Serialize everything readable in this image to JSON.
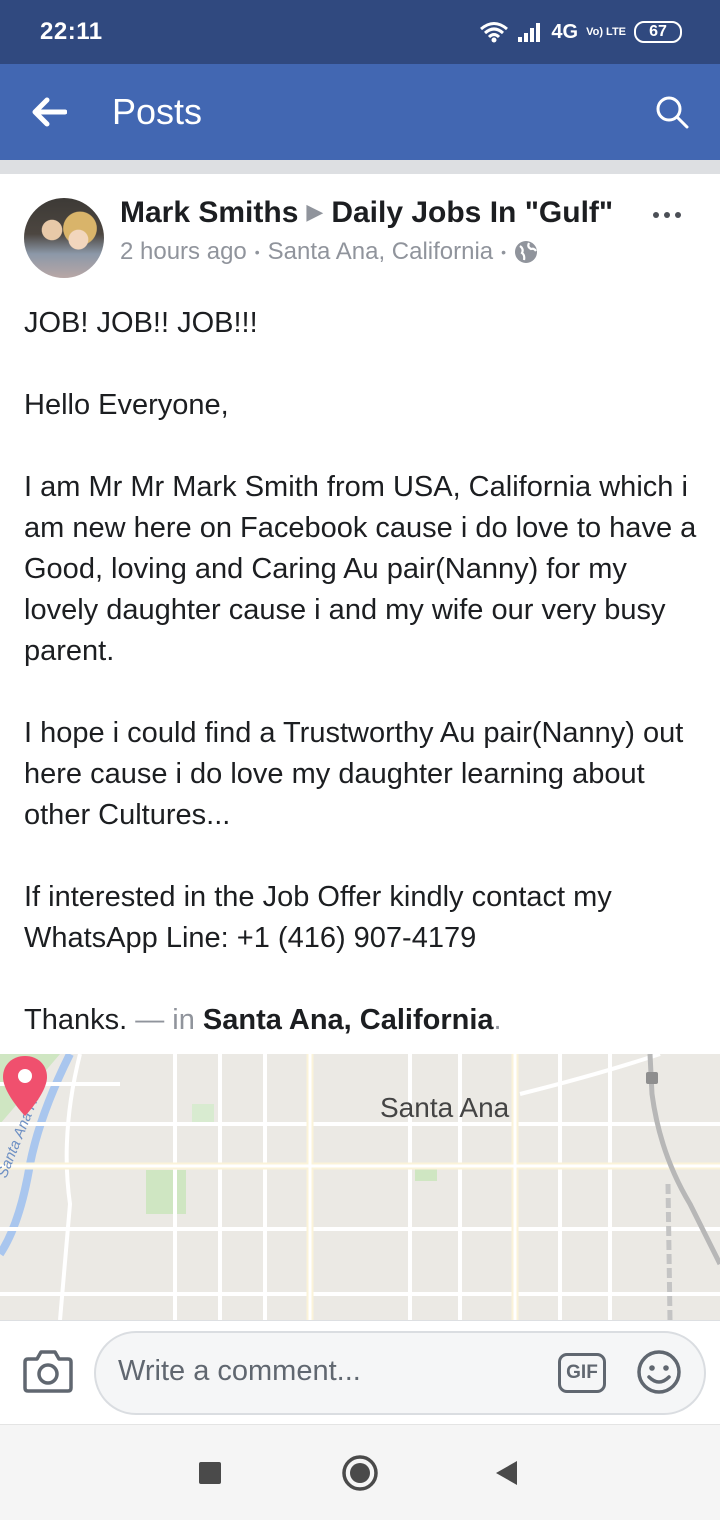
{
  "status_bar": {
    "time": "22:11",
    "network": "4G",
    "network_sub": "Vo) LTE",
    "battery": "67"
  },
  "app_bar": {
    "title": "Posts",
    "back_icon": "arrow-left-icon",
    "search_icon": "search-icon",
    "color": "#4267b2"
  },
  "post": {
    "author": "Mark Smiths",
    "group": "Daily Jobs In \"Gulf\"",
    "time": "2 hours ago",
    "location": "Santa Ana, California",
    "privacy_icon": "globe-icon",
    "more_icon": "more-options-icon",
    "body": {
      "headline": "JOB! JOB!! JOB!!!",
      "greeting": "Hello Everyone,",
      "para1": "I am Mr Mr Mark Smith from USA, California which i am new here on Facebook cause i do love to have a Good, loving and Caring Au pair(Nanny) for my lovely daughter cause i and my wife our very busy parent.",
      "para2": "I hope i could find a Trustworthy Au pair(Nanny) out here cause i do love my daughter learning about other Cultures...",
      "para3": "If interested in the Job Offer kindly contact my WhatsApp Line: +1 (416) 907-4179",
      "thanks": "Thanks.",
      "in_prefix": " — in ",
      "in_location": "Santa Ana, California",
      "in_suffix": "."
    }
  },
  "map": {
    "city_label": "Santa Ana",
    "river_label": "Santa Ana River",
    "pin_color": "#f0506e"
  },
  "comment_bar": {
    "placeholder": "Write a comment...",
    "gif_label": "GIF",
    "camera_icon": "camera-icon",
    "emoji_icon": "emoji-icon"
  },
  "nav_bar": {
    "recents_icon": "square-icon",
    "home_icon": "circle-icon",
    "back_icon": "triangle-back-icon"
  }
}
